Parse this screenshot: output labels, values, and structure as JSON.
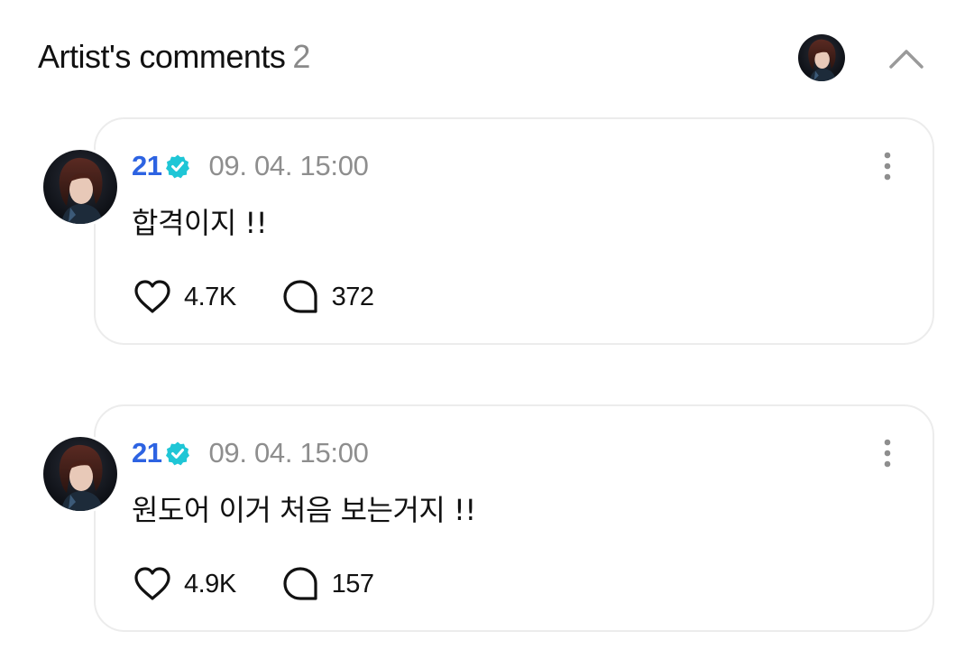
{
  "header": {
    "title": "Artist's comments",
    "count": "2",
    "collapse_icon": "chevron-up-icon"
  },
  "comments": [
    {
      "author": "21",
      "verified_icon": "verified-badge-icon",
      "timestamp": "09. 04. 15:00",
      "text": "합격이지 !!",
      "likes": "4.7K",
      "replies": "372",
      "more_icon": "more-vertical-icon"
    },
    {
      "author": "21",
      "verified_icon": "verified-badge-icon",
      "timestamp": "09. 04. 15:00",
      "text": "원도어 이거 처음 보는거지 !!",
      "likes": "4.9K",
      "replies": "157",
      "more_icon": "more-vertical-icon"
    }
  ],
  "colors": {
    "author": "#2d63e2",
    "verified": "#1fc6d6",
    "muted": "#8e8e8e",
    "card_border": "#ececec"
  }
}
